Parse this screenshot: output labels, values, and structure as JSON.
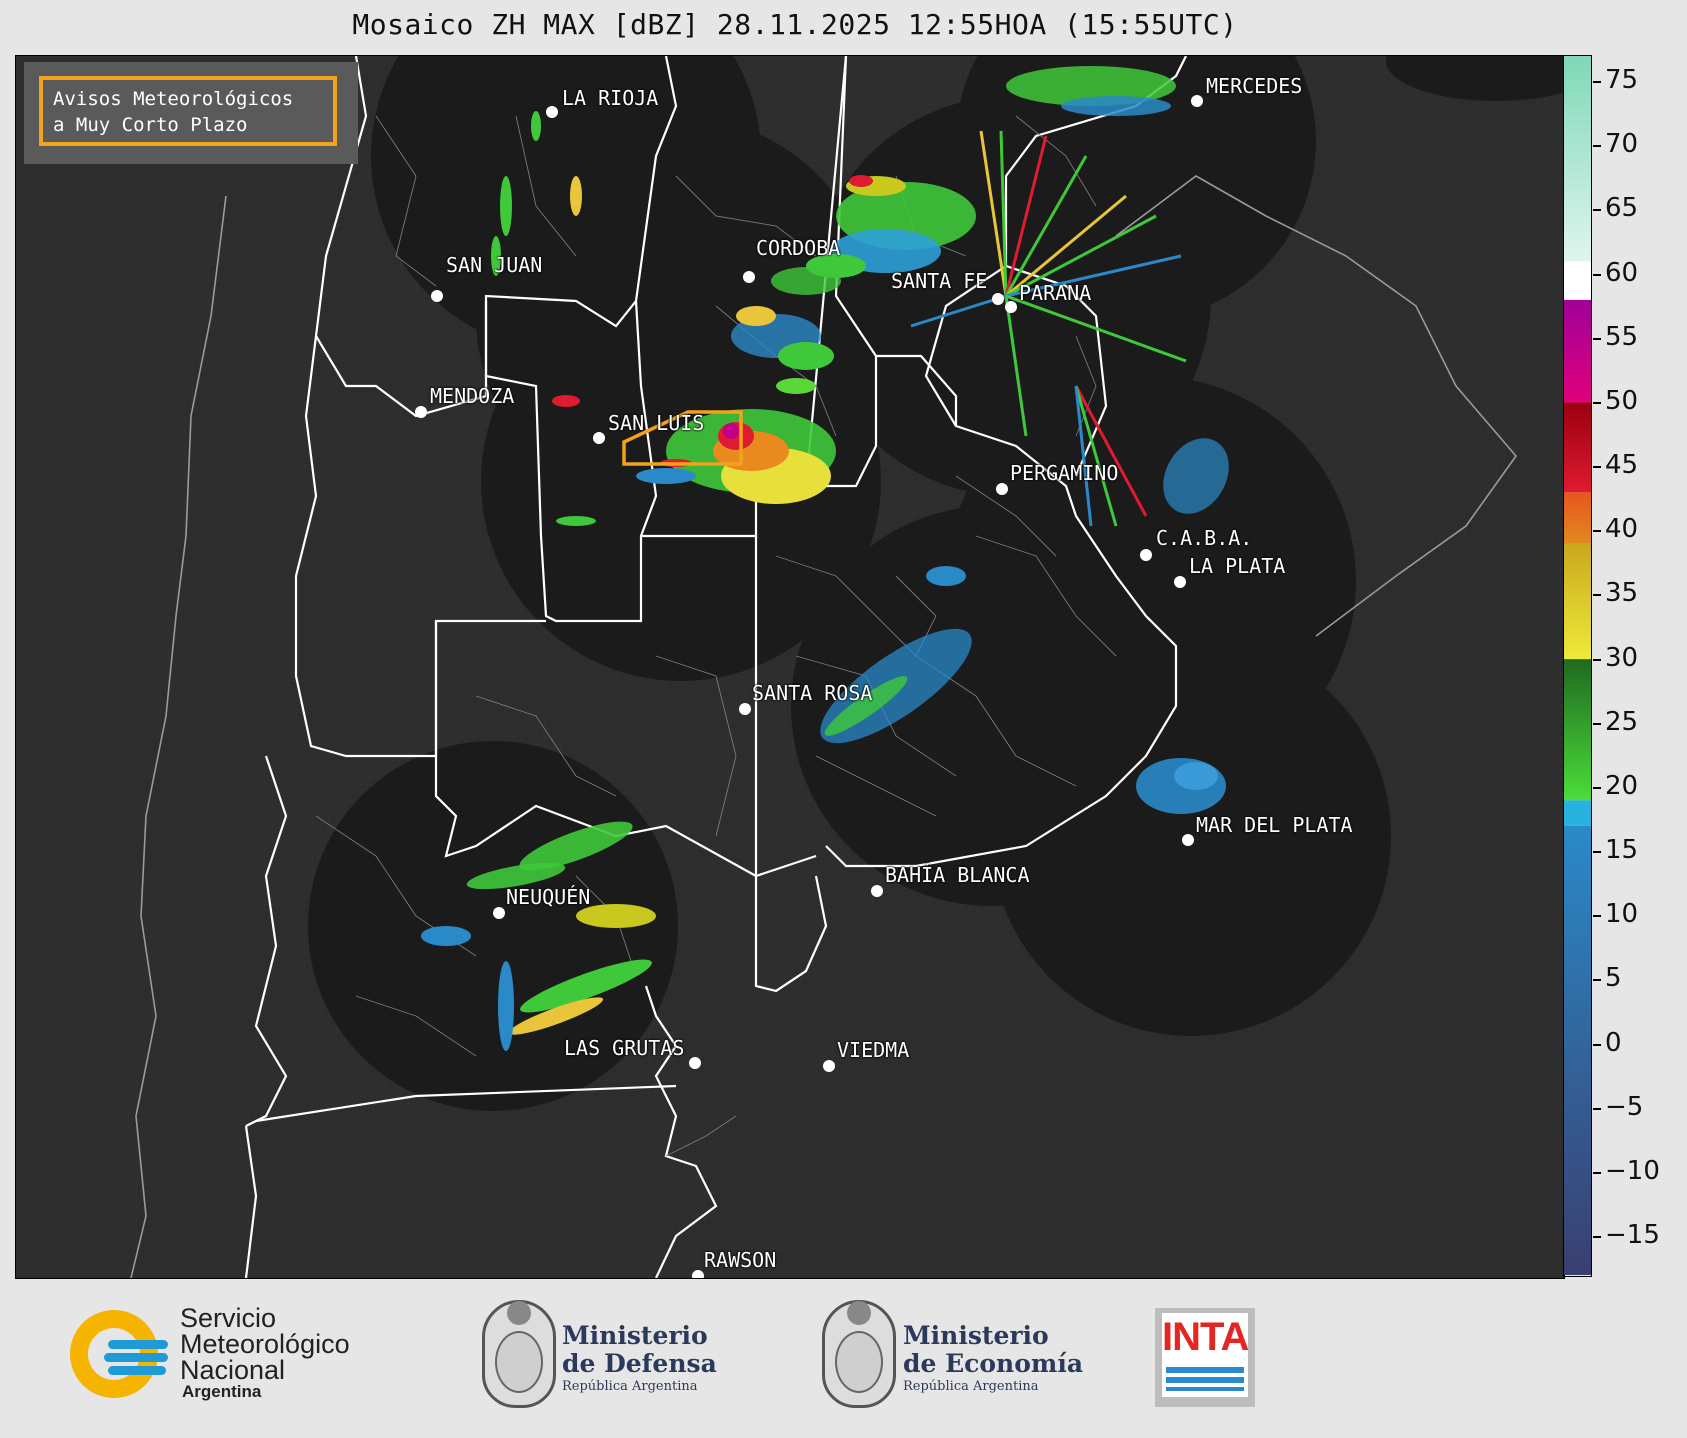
{
  "title": "Mosaico ZH MAX [dBZ] 28.11.2025 12:55HOA (15:55UTC)",
  "legend_box": {
    "line1": "Avisos Meteorológicos",
    "line2": "a Muy Corto Plazo",
    "border_color": "#f3a21b"
  },
  "cities": [
    {
      "id": "la-rioja",
      "label": "LA RIOJA"
    },
    {
      "id": "mercedes",
      "label": "MERCEDES"
    },
    {
      "id": "cordoba",
      "label": "CORDOBA"
    },
    {
      "id": "san-juan",
      "label": "SAN JUAN"
    },
    {
      "id": "santa-fe",
      "label": "SANTA FE"
    },
    {
      "id": "parana",
      "label": "PARANA"
    },
    {
      "id": "mendoza",
      "label": "MENDOZA"
    },
    {
      "id": "san-luis",
      "label": "SAN LUIS"
    },
    {
      "id": "pergamino",
      "label": "PERGAMINO"
    },
    {
      "id": "caba",
      "label": "C.A.B.A."
    },
    {
      "id": "la-plata",
      "label": "LA PLATA"
    },
    {
      "id": "santa-rosa",
      "label": "SANTA ROSA"
    },
    {
      "id": "mar-del-plata",
      "label": "MAR DEL PLATA"
    },
    {
      "id": "bahia-blanca",
      "label": "BAHÍA BLANCA"
    },
    {
      "id": "neuquen",
      "label": "NEUQUÉN"
    },
    {
      "id": "las-grutas",
      "label": "LAS GRUTAS"
    },
    {
      "id": "viedma",
      "label": "VIEDMA"
    },
    {
      "id": "rawson",
      "label": "RAWSON"
    }
  ],
  "colorbar": {
    "unit": "dBZ",
    "range": [
      -18,
      77
    ],
    "ticks": [
      "75",
      "70",
      "65",
      "60",
      "55",
      "50",
      "45",
      "40",
      "35",
      "30",
      "25",
      "20",
      "15",
      "10",
      "5",
      "0",
      "−5",
      "−10",
      "−15"
    ],
    "tick_values": [
      75,
      70,
      65,
      60,
      55,
      50,
      45,
      40,
      35,
      30,
      25,
      20,
      15,
      10,
      5,
      0,
      -5,
      -10,
      -15
    ],
    "bands": [
      {
        "from": -18,
        "to": 17,
        "color_bottom": "#3a3f70",
        "color_top": "#2a8ac8"
      },
      {
        "from": 17,
        "to": 19,
        "color": "#27b2e0"
      },
      {
        "from": 19,
        "to": 30,
        "color_bottom": "#4cdc3a",
        "color_top": "#1f6a1f"
      },
      {
        "from": 30,
        "to": 39,
        "color_bottom": "#eeea3a",
        "color_top": "#c9a81e"
      },
      {
        "from": 39,
        "to": 43,
        "color_bottom": "#e08a1e",
        "color_top": "#e8541e"
      },
      {
        "from": 43,
        "to": 50,
        "color_bottom": "#e01a30",
        "color_top": "#9a0010"
      },
      {
        "from": 50,
        "to": 58,
        "color_bottom": "#e0007a",
        "color_top": "#a0009a"
      },
      {
        "from": 58,
        "to": 61,
        "color": "#ffffff"
      },
      {
        "from": 61,
        "to": 77,
        "color_bottom": "#dff5ee",
        "color_top": "#7fd8b8"
      }
    ]
  },
  "footer": {
    "smn": {
      "line1": "Servicio",
      "line2": "Meteorológico",
      "line3": "Nacional",
      "sub": "Argentina"
    },
    "defensa": {
      "line1": "Ministerio",
      "line2": "de Defensa",
      "sub": "República Argentina"
    },
    "economia": {
      "line1": "Ministerio",
      "line2": "de Economía",
      "sub": "República Argentina"
    },
    "inta": {
      "word": "INTA"
    }
  },
  "colors": {
    "map_background": "#2d2d2d",
    "radar_coverage": "#1b1b1b",
    "province_border": "#ffffff",
    "warning_polygon": "#f3a21b"
  }
}
